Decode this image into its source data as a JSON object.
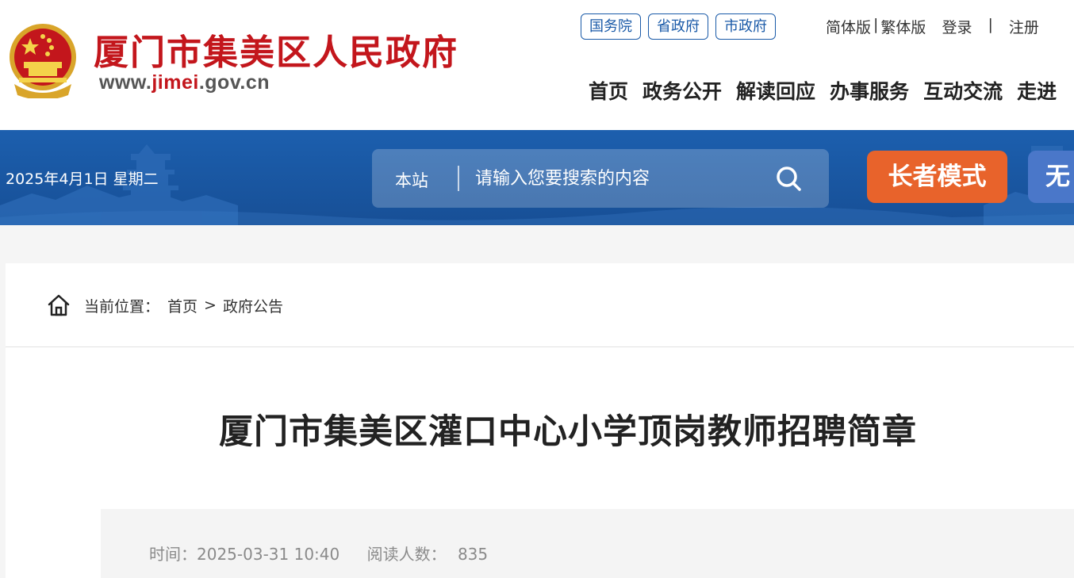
{
  "header": {
    "site_title": "厦门市集美区人民政府",
    "url_prefix": "www.",
    "url_accent": "jimei",
    "url_suffix": ".gov.cn",
    "gov_links": [
      "国务院",
      "省政府",
      "市政府"
    ],
    "lang_simplified": "简体版",
    "lang_separator": "|",
    "lang_traditional": "繁体版",
    "login": "登录",
    "auth_separator": "|",
    "register": "注册",
    "nav": [
      "首页",
      "政务公开",
      "解读回应",
      "办事服务",
      "互动交流",
      "走进"
    ]
  },
  "banner": {
    "date": "2025年4月1日 星期二",
    "search_scope": "本站",
    "search_placeholder": "请输入您要搜索的内容",
    "elder_mode": "长者模式",
    "accessibility": "无"
  },
  "breadcrumb": {
    "prefix": "当前位置：",
    "items": [
      "首页",
      "政府公告"
    ],
    "separator": ">"
  },
  "article": {
    "title": "厦门市集美区灌口中心小学顶岗教师招聘简章",
    "time_label": "时间：",
    "time_value": "2025-03-31 10:40",
    "views_label": "阅读人数：",
    "views_value": "835"
  },
  "colors": {
    "brand_red": "#c3161c",
    "banner_blue": "#1a5aa8",
    "elder_orange": "#e8632b",
    "access_blue": "#4a77c9"
  }
}
